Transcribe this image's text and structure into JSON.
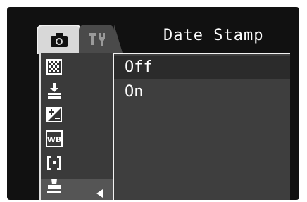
{
  "menu": {
    "title": "Date Stamp",
    "tabs": [
      {
        "name": "camera-tab",
        "icon": "camera-icon",
        "selected": true
      },
      {
        "name": "setup-tab",
        "icon": "wrench-icon",
        "selected": false
      }
    ],
    "sidebar_icons": [
      "quality-icon",
      "drive-mode-icon",
      "exposure-compensation-icon",
      "white-balance-icon",
      "metering-icon",
      "date-stamp-icon"
    ],
    "options": [
      "Off",
      "On"
    ],
    "selected_option": "Off",
    "labels": {
      "wb": "WB"
    }
  }
}
